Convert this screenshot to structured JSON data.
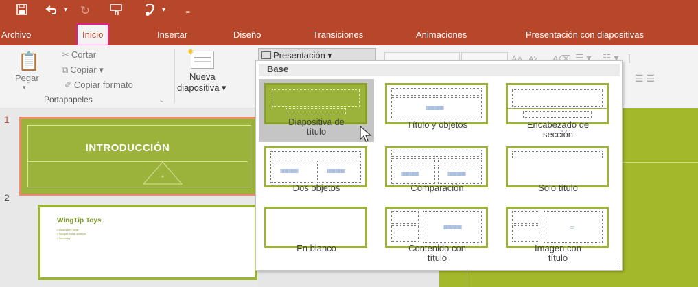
{
  "quick_access": {
    "save_icon": "save-icon",
    "undo_icon": "undo-icon",
    "redo_icon": "redo-icon",
    "touch_icon": "touch-mode-icon",
    "format_icon": "format-painter-icon"
  },
  "tabs": [
    {
      "label": "Archivo"
    },
    {
      "label": "Inicio",
      "active": true
    },
    {
      "label": "Insertar"
    },
    {
      "label": "Diseño"
    },
    {
      "label": "Transiciones"
    },
    {
      "label": "Animaciones"
    },
    {
      "label": "Presentación con diapositivas"
    }
  ],
  "ribbon": {
    "paste_label": "Pegar",
    "cut_label": "Cortar",
    "copy_label": "Copiar",
    "copy_format_label": "Copiar formato",
    "clipboard_group": "Portapapeles",
    "new_slide_label": "Nueva",
    "new_slide_label2": "diapositiva",
    "layout_button": "Presentación"
  },
  "slides": [
    {
      "number": "1",
      "title": "INTRODUCCIÓN"
    },
    {
      "number": "2",
      "title": "WingTip Toys",
      "bullets": [
        "• Main sales page",
        "• Support email addition",
        "• Summary"
      ]
    }
  ],
  "gallery": {
    "header": "Base",
    "layouts": [
      {
        "line1": "Diapositiva de",
        "line2": "título",
        "selected": true
      },
      {
        "line1": "Título y objetos",
        "line2": ""
      },
      {
        "line1": "Encabezado de",
        "line2": "sección"
      },
      {
        "line1": "Dos objetos",
        "line2": ""
      },
      {
        "line1": "Comparación",
        "line2": ""
      },
      {
        "line1": "Solo título",
        "line2": ""
      },
      {
        "line1": "En blanco",
        "line2": ""
      },
      {
        "line1": "Contenido con",
        "line2": "título"
      },
      {
        "line1": "Imagen con",
        "line2": "título"
      }
    ]
  },
  "colors": {
    "titlebar": "#b7472a",
    "accent_green": "#9bb33a",
    "active_outline": "#e61e8c"
  }
}
